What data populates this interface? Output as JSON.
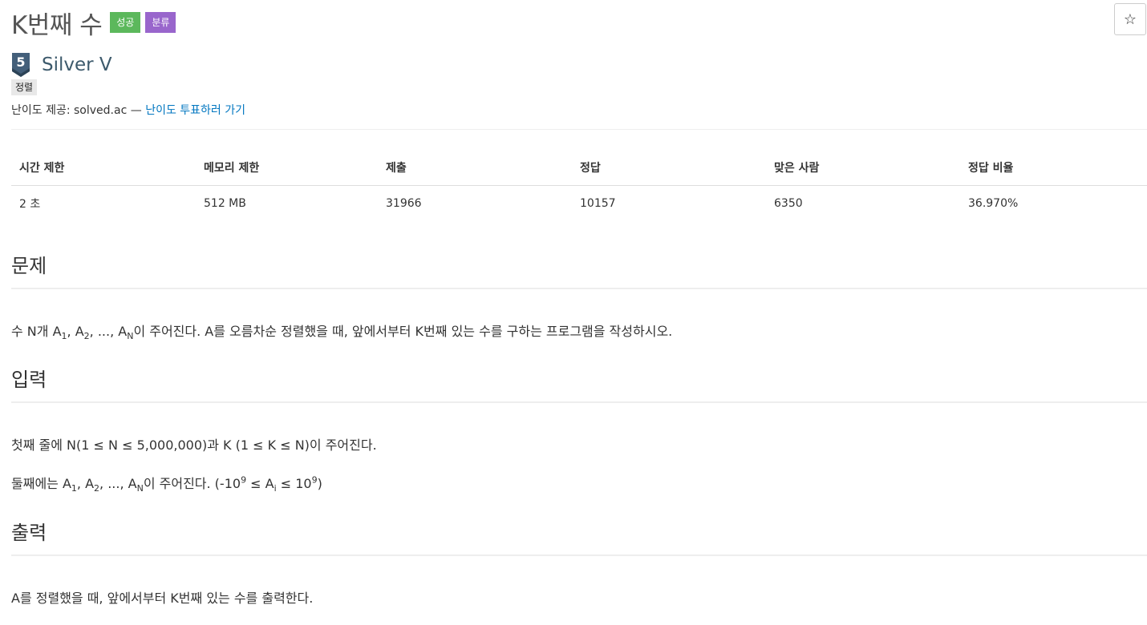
{
  "problem": {
    "title": "K번째 수",
    "badges": {
      "success": "성공",
      "category": "분류"
    },
    "star_icon": "☆"
  },
  "tier": {
    "level": "5",
    "name": "Silver V",
    "color": "#435f7a"
  },
  "tags": [
    "정렬"
  ],
  "provider": {
    "prefix": "난이도 제공: solved.ac — ",
    "link": "난이도 투표하러 가기"
  },
  "info_table": {
    "headers": [
      "시간 제한",
      "메모리 제한",
      "제출",
      "정답",
      "맞은 사람",
      "정답 비율"
    ],
    "values": [
      "2 초",
      "512 MB",
      "31966",
      "10157",
      "6350",
      "36.970%"
    ]
  },
  "sections": {
    "problem": {
      "title": "문제",
      "line1": {
        "t1": "수 N개 A",
        "s1": "1",
        "t2": ", A",
        "s2": "2",
        "t3": ", ..., A",
        "s3": "N",
        "t4": "이 주어진다. A를 오름차순 정렬했을 때, 앞에서부터 K번째 있는 수를 구하는 프로그램을 작성하시오."
      }
    },
    "input": {
      "title": "입력",
      "line1": "첫째 줄에 N(1 ≤ N ≤ 5,000,000)과 K (1 ≤ K ≤ N)이 주어진다.",
      "line2": {
        "t1": "둘째에는 A",
        "s1": "1",
        "t2": ", A",
        "s2": "2",
        "t3": ", ..., A",
        "s3": "N",
        "t4": "이 주어진다. (-10",
        "p1": "9",
        "t5": " ≤ A",
        "s4": "i",
        "t6": " ≤ 10",
        "p2": "9",
        "t7": ")"
      }
    },
    "output": {
      "title": "출력",
      "line1": "A를 정렬했을 때, 앞에서부터 K번째 있는 수를 출력한다."
    }
  },
  "colors": {
    "success": "#5cb85c",
    "category": "#9966cc",
    "link": "#0076c0",
    "accent": "#0076c0"
  }
}
